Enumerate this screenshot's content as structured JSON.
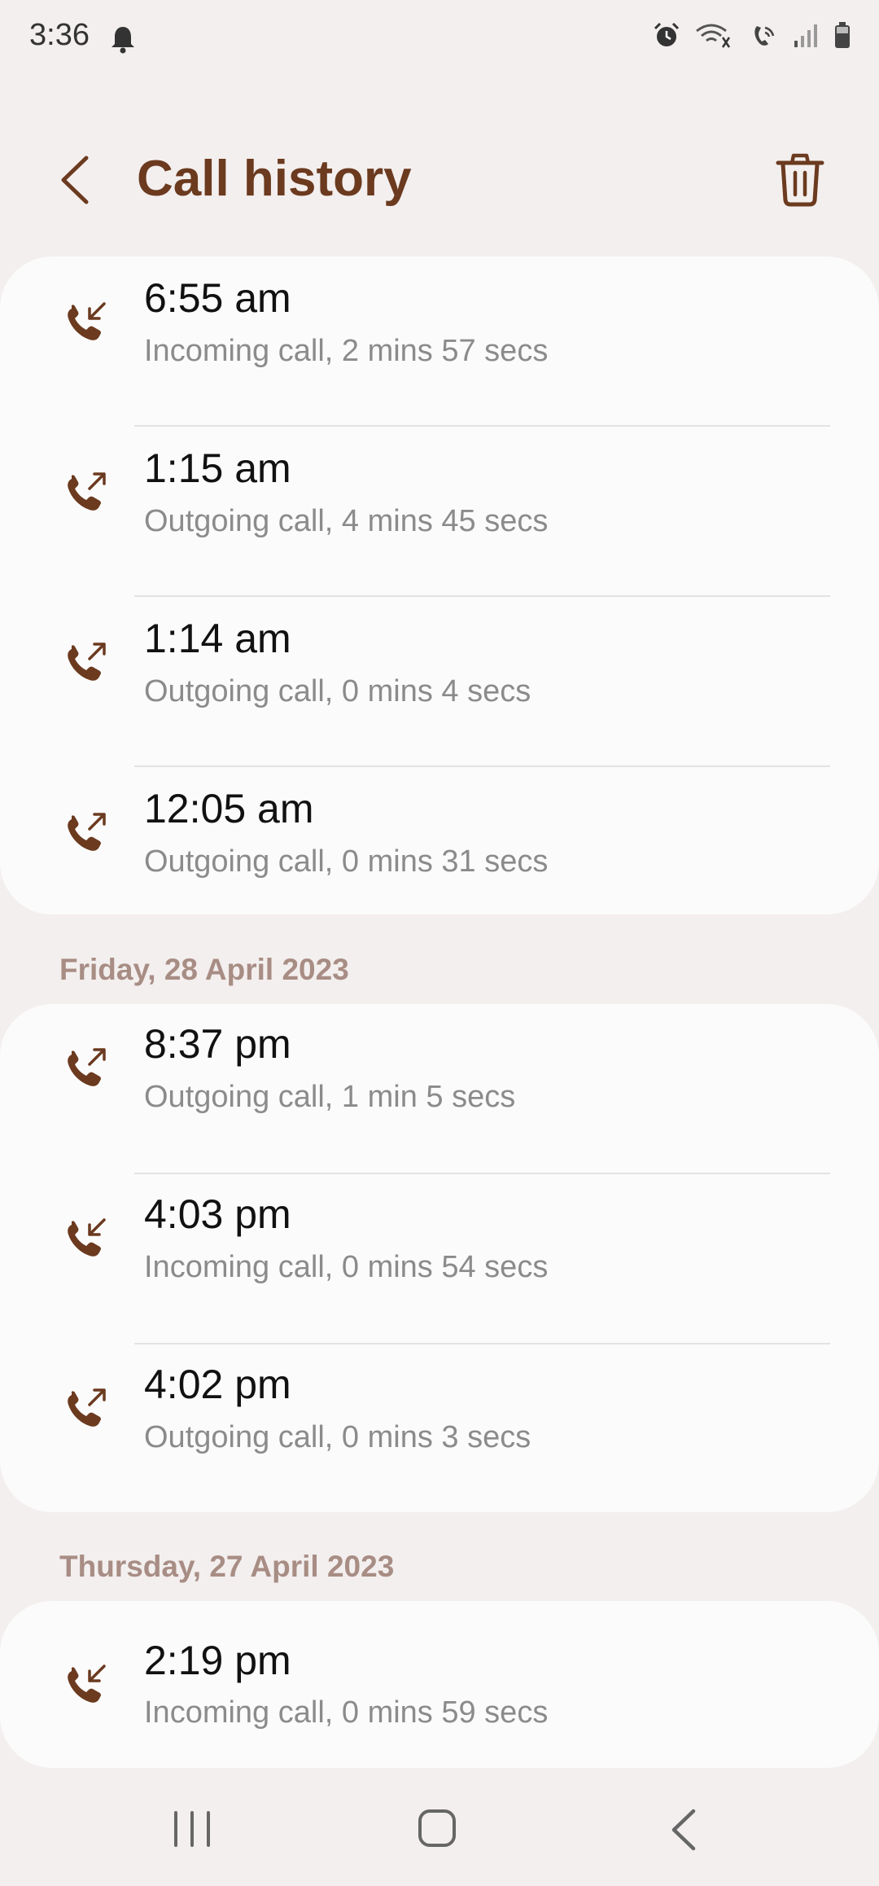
{
  "status_bar": {
    "time": "3:36"
  },
  "header": {
    "title": "Call history"
  },
  "sections": [
    {
      "date": "",
      "calls": [
        {
          "time": "6:55 am",
          "detail": "Incoming call, 2 mins 57 secs",
          "direction": "incoming"
        },
        {
          "time": "1:15 am",
          "detail": "Outgoing call, 4 mins 45 secs",
          "direction": "outgoing"
        },
        {
          "time": "1:14 am",
          "detail": "Outgoing call, 0 mins 4 secs",
          "direction": "outgoing"
        },
        {
          "time": "12:05 am",
          "detail": "Outgoing call, 0 mins 31 secs",
          "direction": "outgoing"
        }
      ]
    },
    {
      "date": "Friday, 28 April 2023",
      "calls": [
        {
          "time": "8:37 pm",
          "detail": "Outgoing call, 1 min 5 secs",
          "direction": "outgoing"
        },
        {
          "time": "4:03 pm",
          "detail": "Incoming call, 0 mins 54 secs",
          "direction": "incoming"
        },
        {
          "time": "4:02 pm",
          "detail": "Outgoing call, 0 mins 3 secs",
          "direction": "outgoing"
        }
      ]
    },
    {
      "date": "Thursday, 27 April 2023",
      "calls": [
        {
          "time": "2:19 pm",
          "detail": "Incoming call, 0 mins 59 secs",
          "direction": "incoming"
        }
      ]
    }
  ],
  "colors": {
    "accent": "#6b3a1f",
    "date_header": "#a88d84",
    "secondary_text": "#8b8b8b",
    "background": "#f3efee",
    "card": "#fbfbfb"
  },
  "icons": {
    "status": [
      "bell-icon",
      "alarm-icon",
      "wifi-calling-icon",
      "wifi-icon",
      "signal-icon",
      "battery-icon"
    ],
    "header": [
      "back-arrow-icon",
      "trash-icon"
    ],
    "nav": [
      "recents-icon",
      "home-icon",
      "back-icon"
    ]
  }
}
